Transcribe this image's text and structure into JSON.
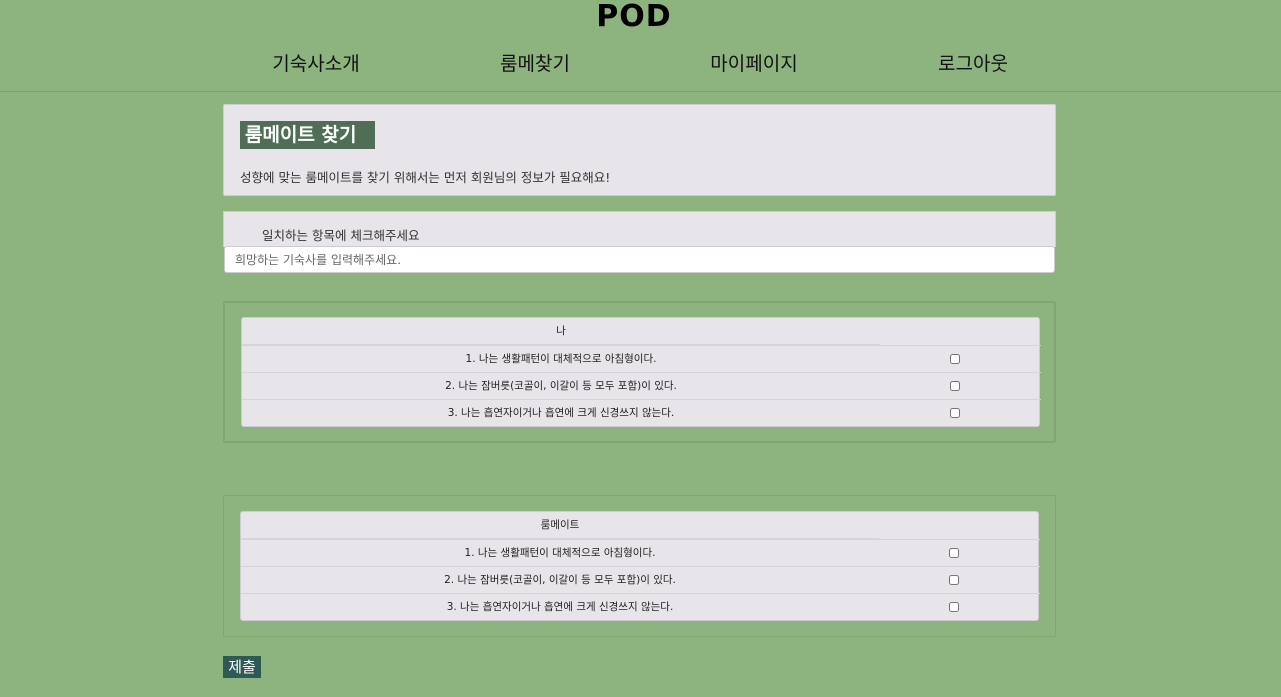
{
  "header": {
    "logo": "POD",
    "nav": [
      "기숙사소개",
      "룸메찾기",
      "마이페이지",
      "로그아웃"
    ]
  },
  "intro": {
    "title": "룸메이트 찾기",
    "subtitle": "성향에 맞는 룸메이트를 찾기 위해서는 먼저 회원님의 정보가 필요해요!"
  },
  "form": {
    "instruction": "일치하는 항목에 체크해주세요",
    "dorm_placeholder": "희망하는 기숙사를 입력해주세요.",
    "dorm_value": ""
  },
  "me_table": {
    "header": "나",
    "items": [
      {
        "text": "1. 나는 생활패턴이 대체적으로 아침형이다.",
        "checked": false
      },
      {
        "text": "2. 나는 잠버릇(코골이, 이갈이 등 모두 포함)이 있다.",
        "checked": false
      },
      {
        "text": "3. 나는 흡연자이거나 흡연에 크게 신경쓰지 않는다.",
        "checked": false
      }
    ]
  },
  "roommate_table": {
    "header": "룸메이트",
    "items": [
      {
        "text": "1. 나는 생활패턴이 대체적으로 아침형이다.",
        "checked": false
      },
      {
        "text": "2. 나는 잠버릇(코골이, 이갈이 등 모두 포함)이 있다.",
        "checked": false
      },
      {
        "text": "3. 나는 흡연자이거나 흡연에 크게 신경쓰지 않는다.",
        "checked": false
      }
    ]
  },
  "submit_label": "제출",
  "colors": {
    "background": "#8db37e",
    "title_bg": "#4f6e55",
    "submit_bg": "#2e5a55",
    "card_bg": "#e8e5ea"
  }
}
